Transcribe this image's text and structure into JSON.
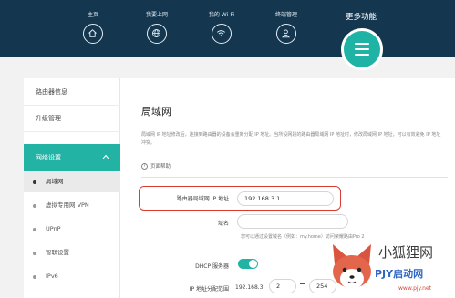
{
  "nav": {
    "items": [
      {
        "label": "主页",
        "icon": "home-icon"
      },
      {
        "label": "我要上网",
        "icon": "globe-icon"
      },
      {
        "label": "我的 Wi-Fi",
        "icon": "wifi-icon"
      },
      {
        "label": "终端管理",
        "icon": "user-icon"
      }
    ],
    "more_label": "更多功能",
    "more_icon": "menu-icon"
  },
  "sidebar": {
    "items": [
      "路由器信息",
      "升级管理",
      "网络设置"
    ],
    "sub_items": [
      "局域网",
      "虚拟专用网 VPN",
      "UPnP",
      "智联设置",
      "IPv6"
    ]
  },
  "main": {
    "title": "局域网",
    "description": "局域网 IP 地址修改后，连接到路由器的设备会重新分配 IP 地址。当所设网段的路由器局域网 IP 地址时，修改局域网 IP 地址，可以有效避免 IP 地址冲突。",
    "help_text": "页面帮助",
    "form": {
      "ip_label": "路由器局域网 IP 地址",
      "ip_value": "192.168.3.1",
      "domain_label": "域名",
      "domain_value": "",
      "domain_hint": "您可以通过设置域名（例如：my.home）访问荣耀路由Pro 2",
      "dhcp_label": "DHCP 服务器",
      "dhcp_enabled": true,
      "range_label": "IP 地址分配范围",
      "range_prefix": "192.168.3.",
      "range_start": "2",
      "range_end": "254"
    }
  },
  "watermark": {
    "title": "小狐狸网",
    "subtitle": "PJY启动网",
    "url": "www.pjy.net"
  },
  "colors": {
    "header_bg": "#14374f",
    "accent": "#22b3a5",
    "highlight_border": "#d83c2f"
  }
}
